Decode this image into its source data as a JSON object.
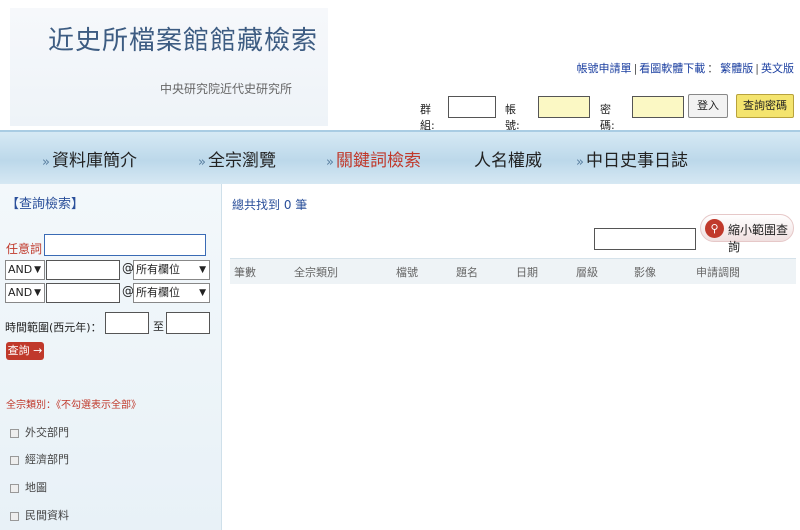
{
  "header": {
    "title": "近史所檔案館館藏檢索",
    "subtitle": "中央研究院近代史研究所",
    "links": [
      "帳號申請單",
      "看圖軟體下載",
      "繁體版",
      "英文版"
    ],
    "login": {
      "group_label": "群組:",
      "account_label": "帳 號:",
      "password_label": "密 碼:",
      "login_button": "登入",
      "query_password_button": "查詢密碼"
    }
  },
  "nav": {
    "items": [
      {
        "label": "資料庫簡介",
        "active": false
      },
      {
        "label": "全宗瀏覽",
        "active": false
      },
      {
        "label": "關鍵詞檢索",
        "active": true
      },
      {
        "label": "人名權威",
        "active": false
      },
      {
        "label": "中日史事日誌",
        "active": false
      }
    ]
  },
  "search": {
    "section_title": "【查詢檢索】",
    "any_label": "任意詞",
    "rows": [
      {
        "operator": "AND",
        "field": "所有欄位"
      },
      {
        "operator": "AND",
        "field": "所有欄位"
      }
    ],
    "at_symbol": "@",
    "time_label": "時間範圍(西元年)：",
    "time_to_label": "至",
    "submit_label": "查詢",
    "category_title": "全宗類別：《不勾選表示全部》",
    "categories": [
      "外交部門",
      "經濟部門",
      "地圖",
      "民間資料"
    ]
  },
  "results": {
    "total_text": "總共找到 0 筆",
    "narrow_button": "縮小範圍查詢",
    "columns": [
      "筆數",
      "全宗類別",
      "檔號",
      "題名",
      "日期",
      "層級",
      "影像",
      "申請調閱"
    ]
  },
  "colors": {
    "nav_bg": "#c5dded",
    "active": "#c0392b",
    "link": "#1b3fa0"
  }
}
